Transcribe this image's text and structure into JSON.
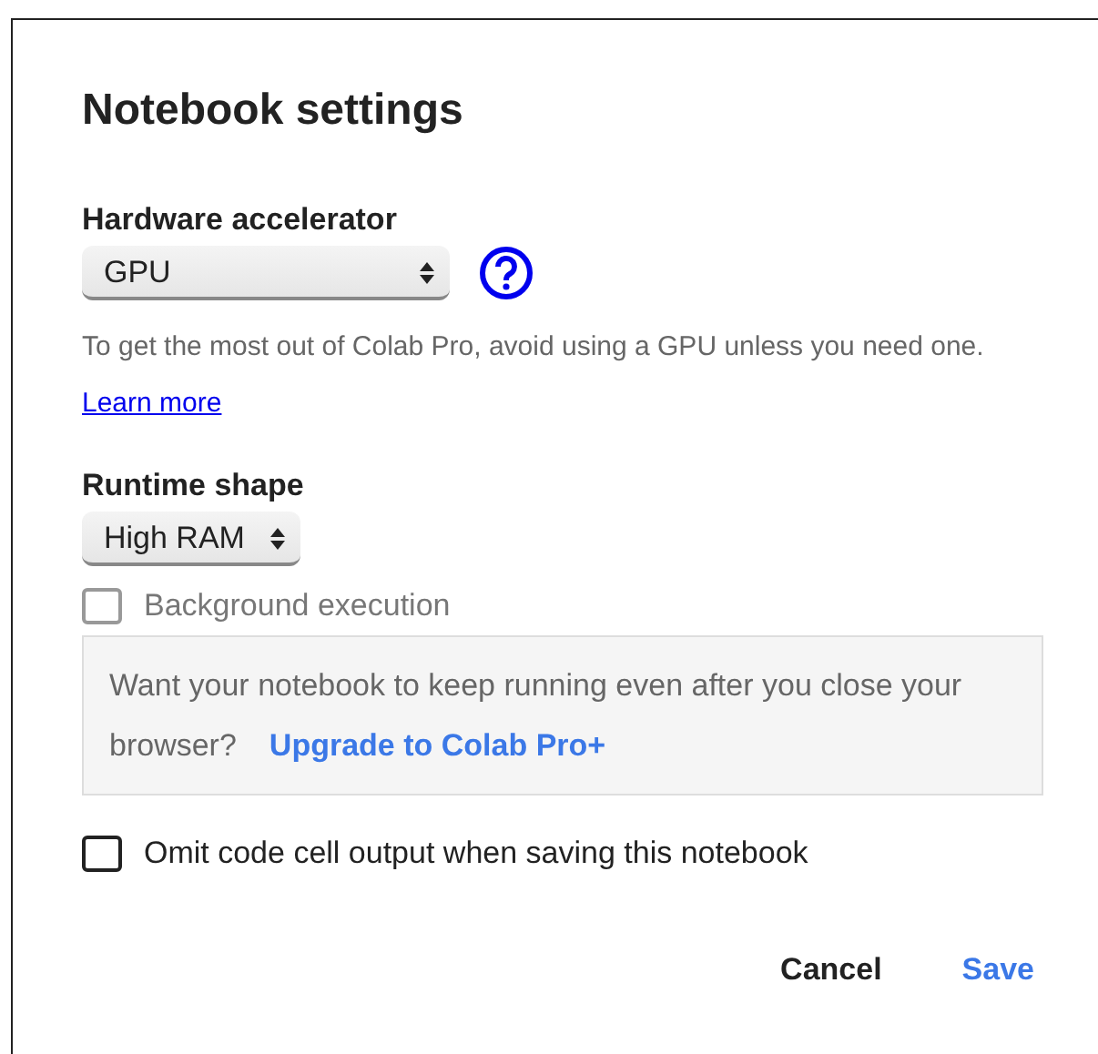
{
  "dialog": {
    "title": "Notebook settings",
    "hardware_accelerator": {
      "label": "Hardware accelerator",
      "value": "GPU",
      "help": "To get the most out of Colab Pro, avoid using a GPU unless you need one.",
      "link": "Learn more"
    },
    "runtime_shape": {
      "label": "Runtime shape",
      "value": "High RAM"
    },
    "background_execution": {
      "label": "Background execution",
      "checked": false,
      "disabled": true
    },
    "upgrade_notice": {
      "text": "Want your notebook to keep running even after you close your browser?",
      "link": "Upgrade to Colab Pro+"
    },
    "omit_output": {
      "label": "Omit code cell output when saving this notebook",
      "checked": false,
      "disabled": false
    },
    "buttons": [
      {
        "label": "Cancel",
        "kind": "neutral"
      },
      {
        "label": "Save",
        "kind": "primary"
      }
    ]
  }
}
